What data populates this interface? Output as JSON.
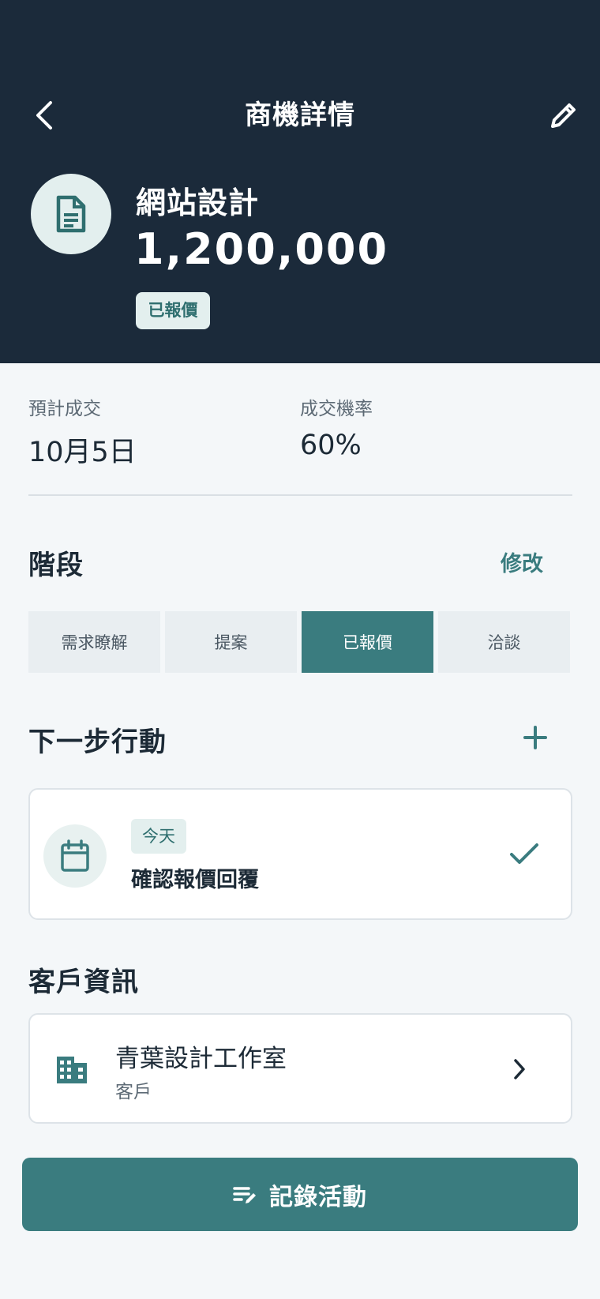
{
  "header": {
    "title": "商機詳情",
    "deal_name": "網站設計",
    "amount": "1,200,000",
    "status_badge": "已報價"
  },
  "stats": [
    {
      "label": "預計成交",
      "value": "10月5日"
    },
    {
      "label": "成交機率",
      "value": "60%"
    }
  ],
  "stage_section": {
    "title": "階段",
    "edit_label": "修改",
    "stages": [
      "需求瞭解",
      "提案",
      "已報價",
      "洽談"
    ],
    "active_index": 2
  },
  "next_action": {
    "title": "下一步行動",
    "task": {
      "badge": "今天",
      "title": "確認報價回覆",
      "done": false
    }
  },
  "client": {
    "title": "客戶資訊",
    "name": "青葉設計工作室",
    "type": "客戶"
  },
  "log_button": {
    "label": "記錄活動"
  },
  "colors": {
    "header_bg": "#1b2a3a",
    "accent": "#3a7c7f",
    "badge_bg": "#e3efee",
    "page_bg": "#f4f7f9"
  },
  "icons": {
    "back": "chevron-left-icon",
    "edit": "pencil-icon",
    "deal": "document-icon",
    "add": "plus-icon",
    "task": "calendar-icon",
    "complete": "check-icon",
    "client": "building-icon",
    "open": "chevron-right-icon",
    "log": "notes-edit-icon"
  }
}
